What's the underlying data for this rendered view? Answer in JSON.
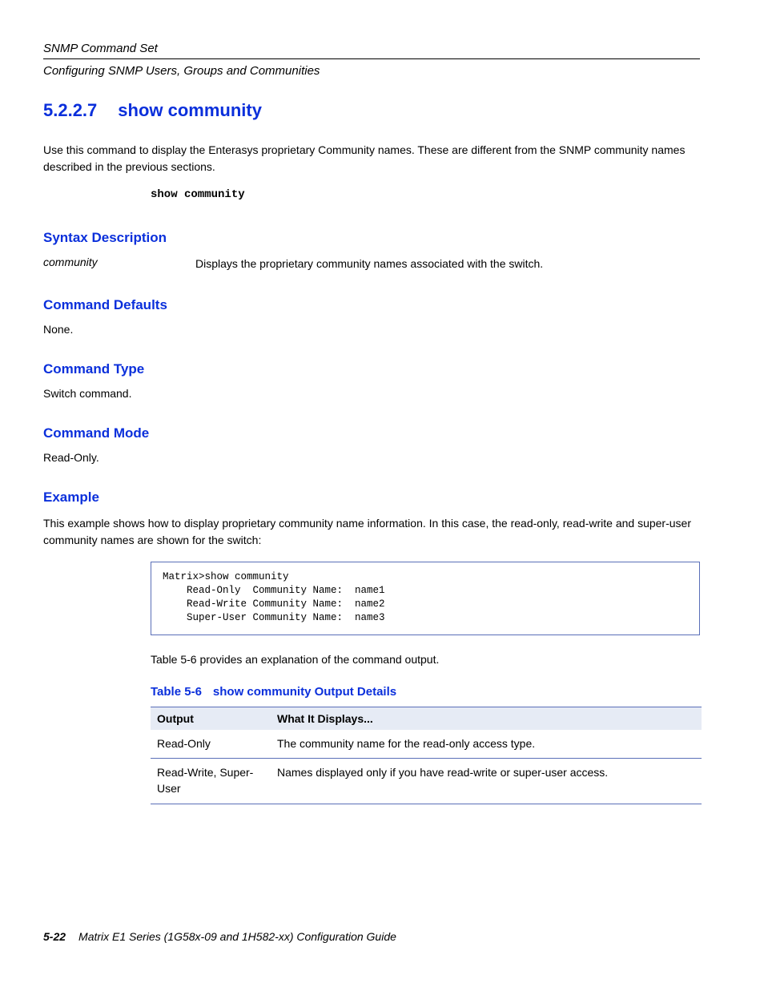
{
  "header": {
    "top": "SNMP Command Set",
    "sub": "Configuring SNMP Users, Groups and Communities"
  },
  "section": {
    "number": "5.2.2.7",
    "title": "show community"
  },
  "intro": "Use this command to display the Enterasys proprietary Community names. These are different from the SNMP community names described in the previous sections.",
  "syntax": "show community",
  "subs": {
    "syntax_desc": {
      "h": "Syntax Description",
      "key": "community",
      "val": "Displays the proprietary community names associated with the switch."
    },
    "defaults": {
      "h": "Command Defaults",
      "val": "None."
    },
    "type": {
      "h": "Command Type",
      "val": "Switch command."
    },
    "mode": {
      "h": "Command Mode",
      "val": "Read-Only."
    },
    "example": {
      "h": "Example",
      "lead": "This example shows how to display proprietary community name information. In this case, the read-only, read-write and super-user community names are shown for the switch:"
    }
  },
  "example_code": "Matrix>show community\n    Read-Only  Community Name:  name1\n    Read-Write Community Name:  name2\n    Super-User Community Name:  name3",
  "table": {
    "caption_num": "Table 5-6",
    "caption_title": "show community Output Details",
    "headers": {
      "c1": "Output",
      "c2": "What It Displays..."
    },
    "rows": [
      {
        "c1": "Read-Only",
        "c2": "The community name for the read-only access type."
      },
      {
        "c1": "Read-Write, Super-User",
        "c2": "Names displayed only if you have read-write or super-user access."
      }
    ]
  },
  "xref_pre": " provides an explanation of the command output.",
  "xref": "Table 5-6",
  "footer": {
    "page": "5-22",
    "title": "Matrix E1 Series (1G58x-09 and 1H582-xx) Configuration Guide"
  }
}
